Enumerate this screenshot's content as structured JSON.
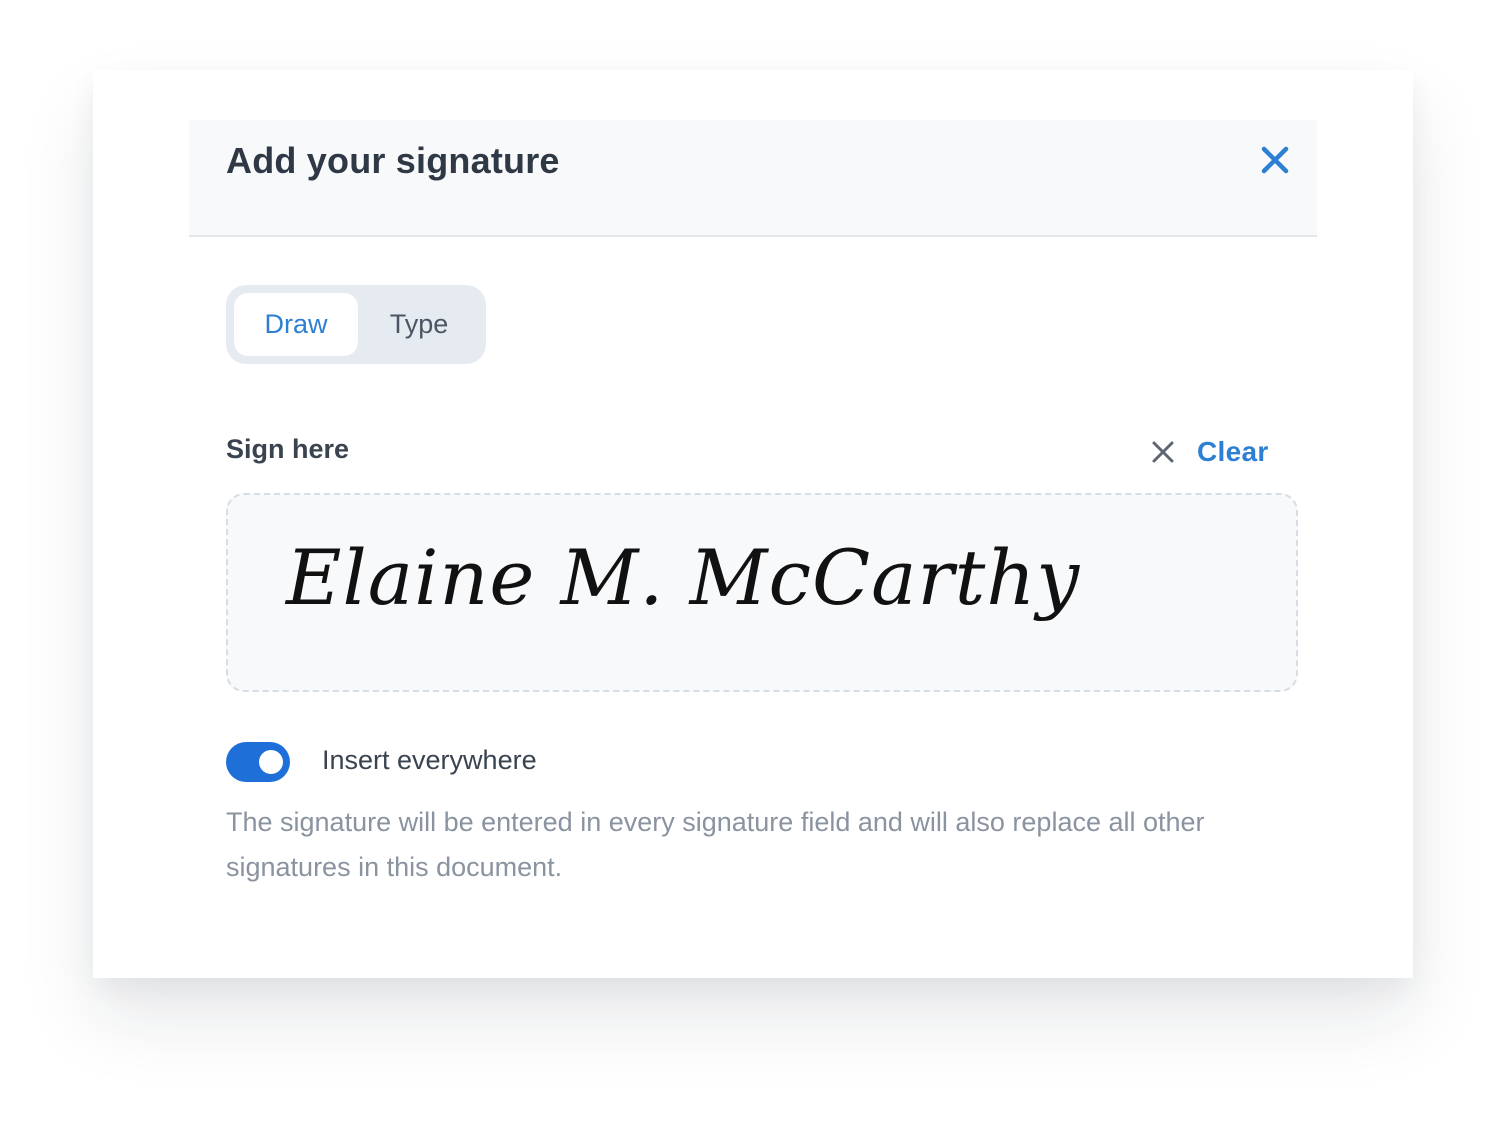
{
  "dialog": {
    "title": "Add your signature",
    "close_icon": "close-icon",
    "accent_color": "#2d7fd3"
  },
  "tabs": [
    {
      "label": "Draw",
      "active": true
    },
    {
      "label": "Type",
      "active": false
    }
  ],
  "sign_area": {
    "label": "Sign here",
    "clear_label": "Clear",
    "clear_icon": "close-icon",
    "signature_text": "Elaine M. McCarthy"
  },
  "insert_everywhere": {
    "enabled": true,
    "label": "Insert everywhere",
    "toggle_color": "#1f6fd9",
    "description": "The signature will be entered in every signature field and will also replace all other signatures in this document."
  }
}
